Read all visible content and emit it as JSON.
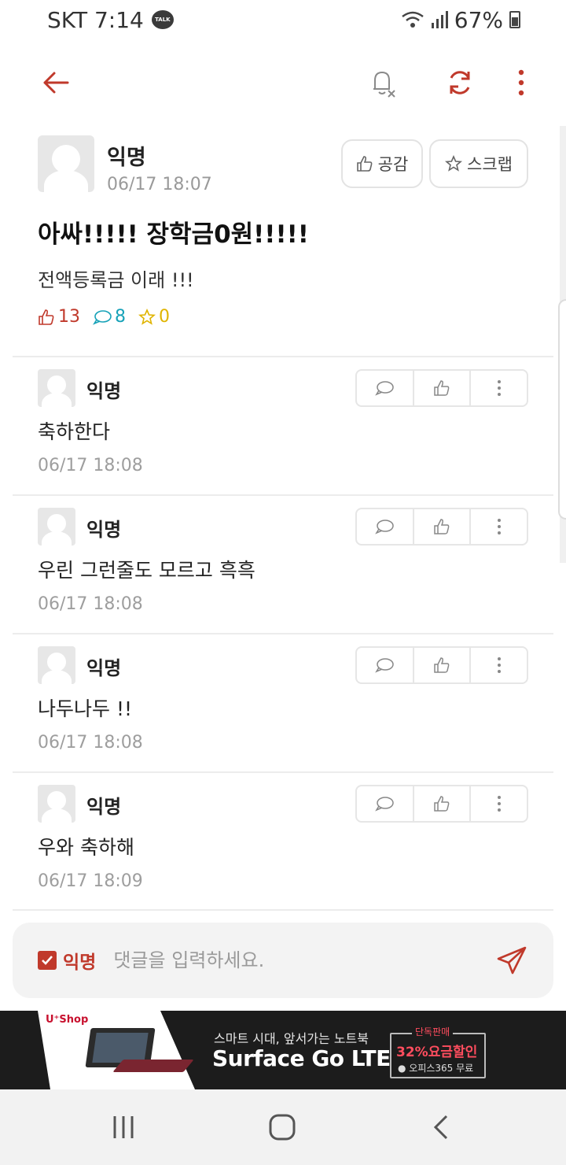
{
  "status_bar": {
    "carrier_time": "SKT 7:14",
    "talk_badge": "TALK",
    "battery": "67%"
  },
  "toolbar": {
    "back_icon": "arrow-left-icon",
    "mute_icon": "bell-off-icon",
    "refresh_icon": "refresh-icon",
    "more_icon": "more-vertical-icon",
    "accent_color": "#c0392b"
  },
  "post": {
    "author": "익명",
    "date": "06/17 18:07",
    "like_button": "공감",
    "scrap_button": "스크랩",
    "title": "아싸!!!!! 장학금0원!!!!!",
    "body": "전액등록금 이래 !!!",
    "likes": "13",
    "comments": "8",
    "scraps": "0"
  },
  "comments": [
    {
      "author": "익명",
      "text": "축하한다",
      "time": "06/17 18:08"
    },
    {
      "author": "익명",
      "text": "우린 그런줄도 모르고 흑흑",
      "time": "06/17 18:08"
    },
    {
      "author": "익명",
      "text": "나두나두 !!",
      "time": "06/17 18:08"
    },
    {
      "author": "익명",
      "text": "우와 축하해",
      "time": "06/17 18:09"
    }
  ],
  "comment_input": {
    "anonymous_label": "익명",
    "anonymous_checked": true,
    "placeholder": "댓글을 입력하세요."
  },
  "ad": {
    "brand": "U⁺Shop",
    "subtitle": "스마트 시대, 앞서가는 노트북",
    "title": "Surface Go LTE",
    "tag": "단독판매",
    "discount": "32%요금할인",
    "offer": "● 오피스365 무료"
  }
}
